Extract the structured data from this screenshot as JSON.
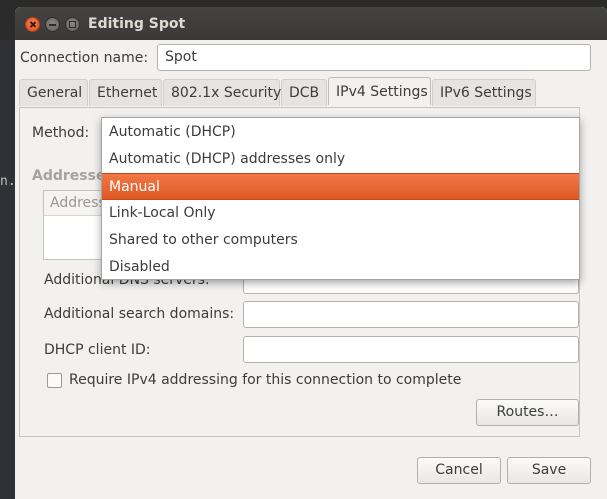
{
  "window": {
    "title": "Editing Spot"
  },
  "background": {
    "terminal_text": "n."
  },
  "connection": {
    "name_label": "Connection name:",
    "name_value": "Spot"
  },
  "tabs": [
    {
      "label": "General"
    },
    {
      "label": "Ethernet"
    },
    {
      "label": "802.1x Security"
    },
    {
      "label": "DCB"
    },
    {
      "label": "IPv4 Settings"
    },
    {
      "label": "IPv6 Settings"
    }
  ],
  "active_tab": "IPv4 Settings",
  "ipv4": {
    "method_label": "Method:",
    "addresses_label": "Addresses",
    "address_column": "Address",
    "dns_label": "Additional DNS servers:",
    "search_label": "Additional search domains:",
    "dhcp_label": "DHCP client ID:",
    "require_label": "Require IPv4 addressing for this connection to complete",
    "require_checked": false,
    "routes_button": "Routes…"
  },
  "method_dropdown": {
    "selected": "Manual",
    "options": [
      "Automatic (DHCP)",
      "Automatic (DHCP) addresses only",
      "Manual",
      "Link-Local Only",
      "Shared to other computers",
      "Disabled"
    ]
  },
  "footer": {
    "cancel": "Cancel",
    "save": "Save"
  },
  "colors": {
    "accent": "#e9602c",
    "titlebar": "#3c3b37",
    "window_bg": "#f2f1f0"
  }
}
